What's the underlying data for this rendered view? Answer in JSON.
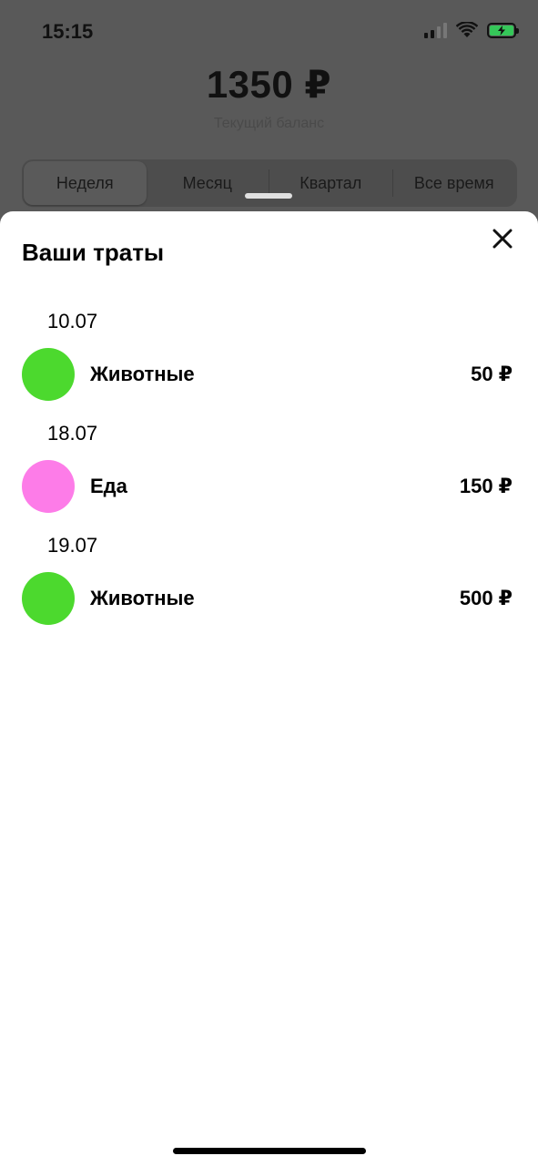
{
  "status_bar": {
    "time": "15:15"
  },
  "balance": {
    "amount": "1350 ₽",
    "label": "Текущий баланс"
  },
  "periods": [
    {
      "label": "Неделя",
      "active": true
    },
    {
      "label": "Месяц",
      "active": false
    },
    {
      "label": "Квартал",
      "active": false
    },
    {
      "label": "Все время",
      "active": false
    }
  ],
  "sheet": {
    "title": "Ваши траты",
    "close_icon": "close-icon",
    "entries": [
      {
        "date": "10.07",
        "category": "Животные",
        "amount": "50 ₽",
        "color": "#4cd92e"
      },
      {
        "date": "18.07",
        "category": "Еда",
        "amount": "150 ₽",
        "color": "#fd7ce8"
      },
      {
        "date": "19.07",
        "category": "Животные",
        "amount": "500 ₽",
        "color": "#4cd92e"
      }
    ]
  }
}
